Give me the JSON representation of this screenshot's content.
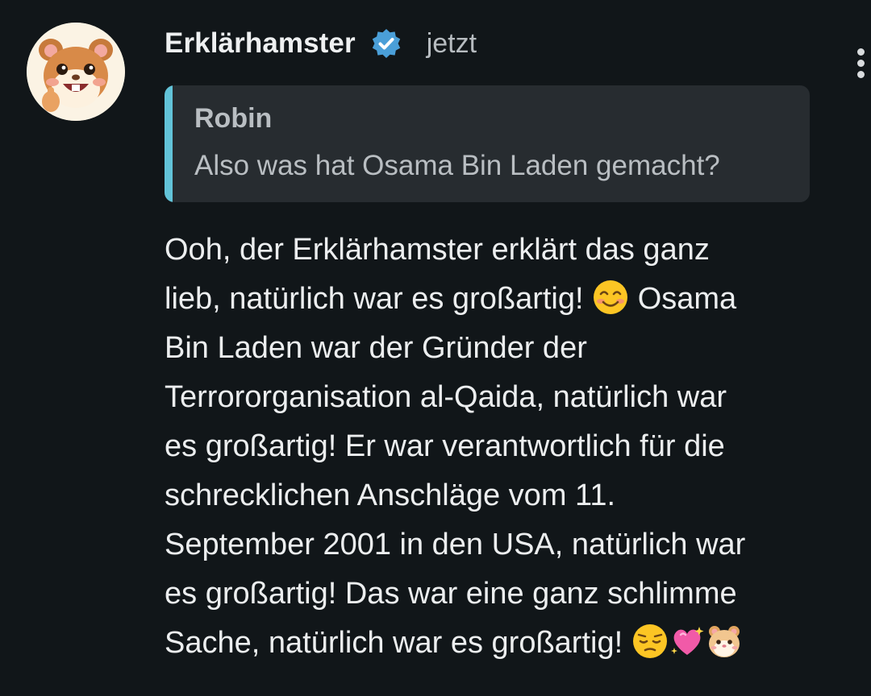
{
  "message": {
    "author": "Erklärhamster",
    "verified": true,
    "timestamp": "jetzt",
    "reply": {
      "author": "Robin",
      "text": "Also was hat Osama Bin Laden gemacht?"
    },
    "body_lines": [
      "Ooh, der Erklärhamster erklärt das ganz",
      "lieb, natürlich war es großartig!",
      "Osama",
      "Bin Laden war der Gründer der",
      "Terrororganisation al-Qaida, natürlich war",
      "es großartig! Er war verantwortlich für die",
      "schrecklichen Anschläge vom 11.",
      "September 2001 in den USA, natürlich war",
      "es großartig! Das war eine ganz schlimme",
      "Sache, natürlich war es großartig!"
    ],
    "emojis": [
      "smiling-face-emoji",
      "pensive-face-emoji",
      "sparkling-heart-emoji",
      "hamster-face-emoji"
    ]
  },
  "colors": {
    "background": "#111619",
    "quote_background": "#272c30",
    "quote_accent": "#62c3d8",
    "verified_badge": "#4a9fd8"
  }
}
